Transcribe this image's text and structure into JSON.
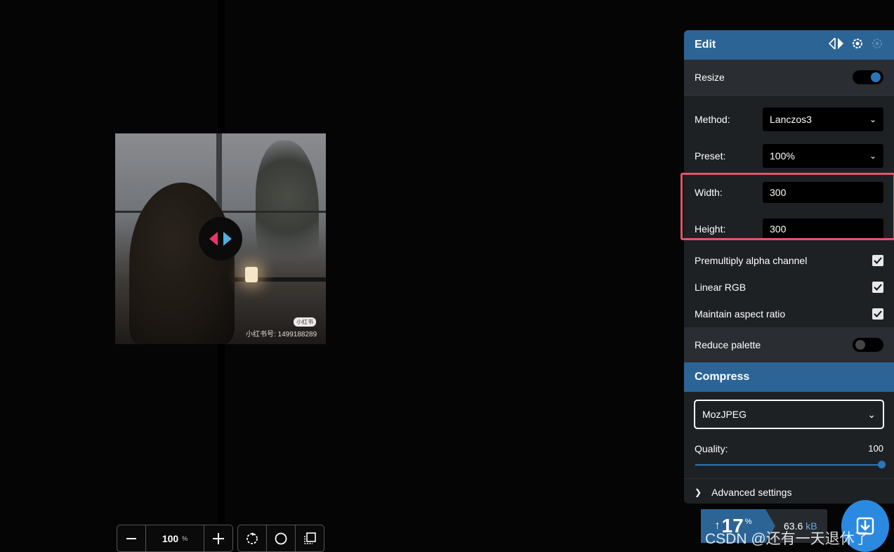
{
  "image": {
    "watermark_badge": "小红书",
    "watermark_text": "小红书号: 1499188289"
  },
  "zoom": {
    "value": "100",
    "unit": "%"
  },
  "edit": {
    "title": "Edit",
    "resize": {
      "label": "Resize",
      "enabled": true
    },
    "method": {
      "label": "Method:",
      "value": "Lanczos3"
    },
    "preset": {
      "label": "Preset:",
      "value": "100%"
    },
    "width": {
      "label": "Width:",
      "value": "300"
    },
    "height": {
      "label": "Height:",
      "value": "300"
    },
    "premultiply": {
      "label": "Premultiply alpha channel",
      "checked": true
    },
    "linear_rgb": {
      "label": "Linear RGB",
      "checked": true
    },
    "aspect": {
      "label": "Maintain aspect ratio",
      "checked": true
    },
    "reduce_palette": {
      "label": "Reduce palette",
      "enabled": false
    }
  },
  "compress": {
    "title": "Compress",
    "codec": "MozJPEG",
    "quality_label": "Quality:",
    "quality_value": "100",
    "advanced_label": "Advanced settings"
  },
  "result": {
    "percent": "17",
    "percent_sym": "%",
    "size": "63.6",
    "size_unit": "kB"
  },
  "credit": "CSDN @还有一天退休了",
  "colors": {
    "accent": "#2c6495",
    "highlight": "#e0566b",
    "panel_bg": "#1e2124"
  }
}
